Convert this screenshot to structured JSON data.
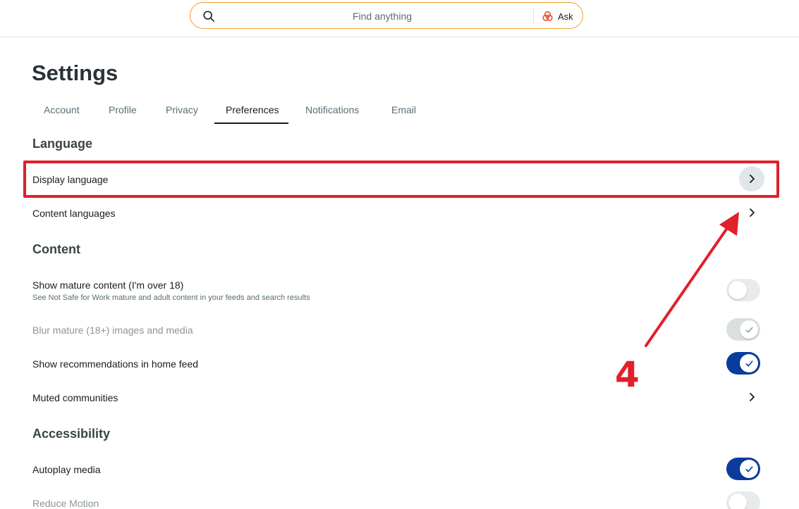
{
  "search": {
    "placeholder": "Find anything",
    "ask_label": "Ask"
  },
  "page": {
    "title": "Settings"
  },
  "tabs": [
    {
      "label": "Account"
    },
    {
      "label": "Profile"
    },
    {
      "label": "Privacy"
    },
    {
      "label": "Preferences",
      "active": true
    },
    {
      "label": "Notifications"
    },
    {
      "label": "Email"
    }
  ],
  "sections": {
    "language": {
      "heading": "Language",
      "display_language": "Display language",
      "content_languages": "Content languages"
    },
    "content": {
      "heading": "Content",
      "mature_label": "Show mature content (I'm over 18)",
      "mature_desc": "See Not Safe for Work mature and adult content in your feeds and search results",
      "mature_enabled": false,
      "blur_label": "Blur mature (18+) images and media",
      "blur_enabled": true,
      "blur_disabled": true,
      "recommendations_label": "Show recommendations in home feed",
      "recommendations_enabled": true,
      "muted_label": "Muted communities"
    },
    "accessibility": {
      "heading": "Accessibility",
      "autoplay_label": "Autoplay media",
      "autoplay_enabled": true,
      "reduce_motion_label": "Reduce Motion"
    }
  },
  "annotation": {
    "step_number": "4",
    "color": "#e0202a"
  },
  "colors": {
    "accent": "#0a3c9e",
    "search_border": "#f0a030"
  },
  "icons": {
    "search": "search-icon",
    "ask": "ask-icon",
    "chevron": "chevron-right-icon",
    "check": "check-icon"
  }
}
